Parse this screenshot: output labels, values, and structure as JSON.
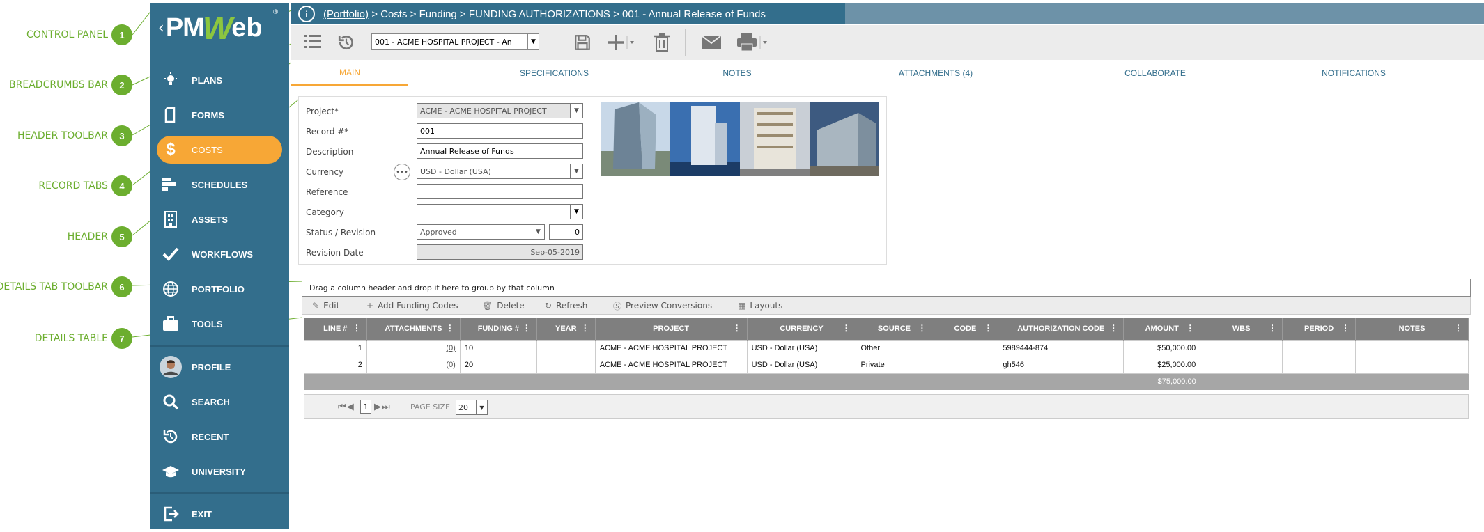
{
  "callouts": [
    {
      "n": "1",
      "label": "CONTROL PANEL"
    },
    {
      "n": "2",
      "label": "BREADCRUMBS BAR"
    },
    {
      "n": "3",
      "label": "HEADER TOOLBAR"
    },
    {
      "n": "4",
      "label": "RECORD TABS"
    },
    {
      "n": "5",
      "label": "HEADER"
    },
    {
      "n": "6",
      "label": "DETAILS TAB TOOLBAR"
    },
    {
      "n": "7",
      "label": "DETAILS TABLE"
    }
  ],
  "logo": {
    "chev": "‹",
    "pm": "PM",
    "w": "W",
    "eb": "eb",
    "reg": "®"
  },
  "sidebar": {
    "items": [
      {
        "label": "PLANS",
        "icon": "lightbulb-icon"
      },
      {
        "label": "FORMS",
        "icon": "document-icon"
      },
      {
        "label": "COSTS",
        "icon": "dollar-icon"
      },
      {
        "label": "SCHEDULES",
        "icon": "gantt-icon"
      },
      {
        "label": "ASSETS",
        "icon": "building-icon"
      },
      {
        "label": "WORKFLOWS",
        "icon": "checkmark-icon"
      },
      {
        "label": "PORTFOLIO",
        "icon": "globe-icon"
      },
      {
        "label": "TOOLS",
        "icon": "briefcase-icon"
      },
      {
        "label": "PROFILE",
        "icon": "avatar-icon"
      },
      {
        "label": "SEARCH",
        "icon": "search-icon"
      },
      {
        "label": "RECENT",
        "icon": "history-icon"
      },
      {
        "label": "UNIVERSITY",
        "icon": "graduation-cap-icon"
      },
      {
        "label": "EXIT",
        "icon": "exit-icon"
      }
    ]
  },
  "breadcrumb": {
    "link": "(Portfolio)",
    "rest": " > Costs > Funding > FUNDING AUTHORIZATIONS > 001 - Annual Release of Funds"
  },
  "toolbar": {
    "record_select": "001 - ACME HOSPITAL PROJECT - An"
  },
  "tabs": [
    "MAIN",
    "SPECIFICATIONS",
    "NOTES",
    "ATTACHMENTS (4)",
    "COLLABORATE",
    "NOTIFICATIONS"
  ],
  "header": {
    "labels": {
      "project": "Project*",
      "record": "Record #*",
      "description": "Description",
      "currency": "Currency",
      "reference": "Reference",
      "category": "Category",
      "status": "Status / Revision",
      "revision_date": "Revision Date"
    },
    "values": {
      "project": "ACME - ACME HOSPITAL PROJECT",
      "record": "001",
      "description": "Annual Release of Funds",
      "currency": "USD - Dollar (USA)",
      "reference": "",
      "category": "",
      "status": "Approved",
      "revision": "0",
      "revision_date": "Sep-05-2019"
    },
    "dots": "•••"
  },
  "grid": {
    "group_hint": "Drag a column header and drop it here to group by that column",
    "toolbar": [
      "Edit",
      "Add Funding Codes",
      "Delete",
      "Refresh",
      "Preview Conversions",
      "Layouts"
    ],
    "columns": [
      "LINE #",
      "ATTACHMENTS",
      "FUNDING #",
      "YEAR",
      "PROJECT",
      "CURRENCY",
      "SOURCE",
      "CODE",
      "AUTHORIZATION CODE",
      "AMOUNT",
      "WBS",
      "PERIOD",
      "NOTES"
    ],
    "rows": [
      {
        "line": "1",
        "attachments": "(0)",
        "funding": "10",
        "year": "",
        "project": "ACME - ACME HOSPITAL PROJECT",
        "currency": "USD - Dollar (USA)",
        "source": "Other",
        "code": "",
        "auth": "5989444-874",
        "amount": "$50,000.00",
        "wbs": "",
        "period": "",
        "notes": ""
      },
      {
        "line": "2",
        "attachments": "(0)",
        "funding": "20",
        "year": "",
        "project": "ACME - ACME HOSPITAL PROJECT",
        "currency": "USD - Dollar (USA)",
        "source": "Private",
        "code": "",
        "auth": "gh546",
        "amount": "$25,000.00",
        "wbs": "",
        "period": "",
        "notes": ""
      }
    ],
    "total": "$75,000.00",
    "pager": {
      "page": "1",
      "size_label": "PAGE SIZE",
      "size": "20"
    }
  },
  "colors": {
    "sidebar": "#336e8c",
    "accent": "#f7a736",
    "callout": "#6cae2f"
  }
}
